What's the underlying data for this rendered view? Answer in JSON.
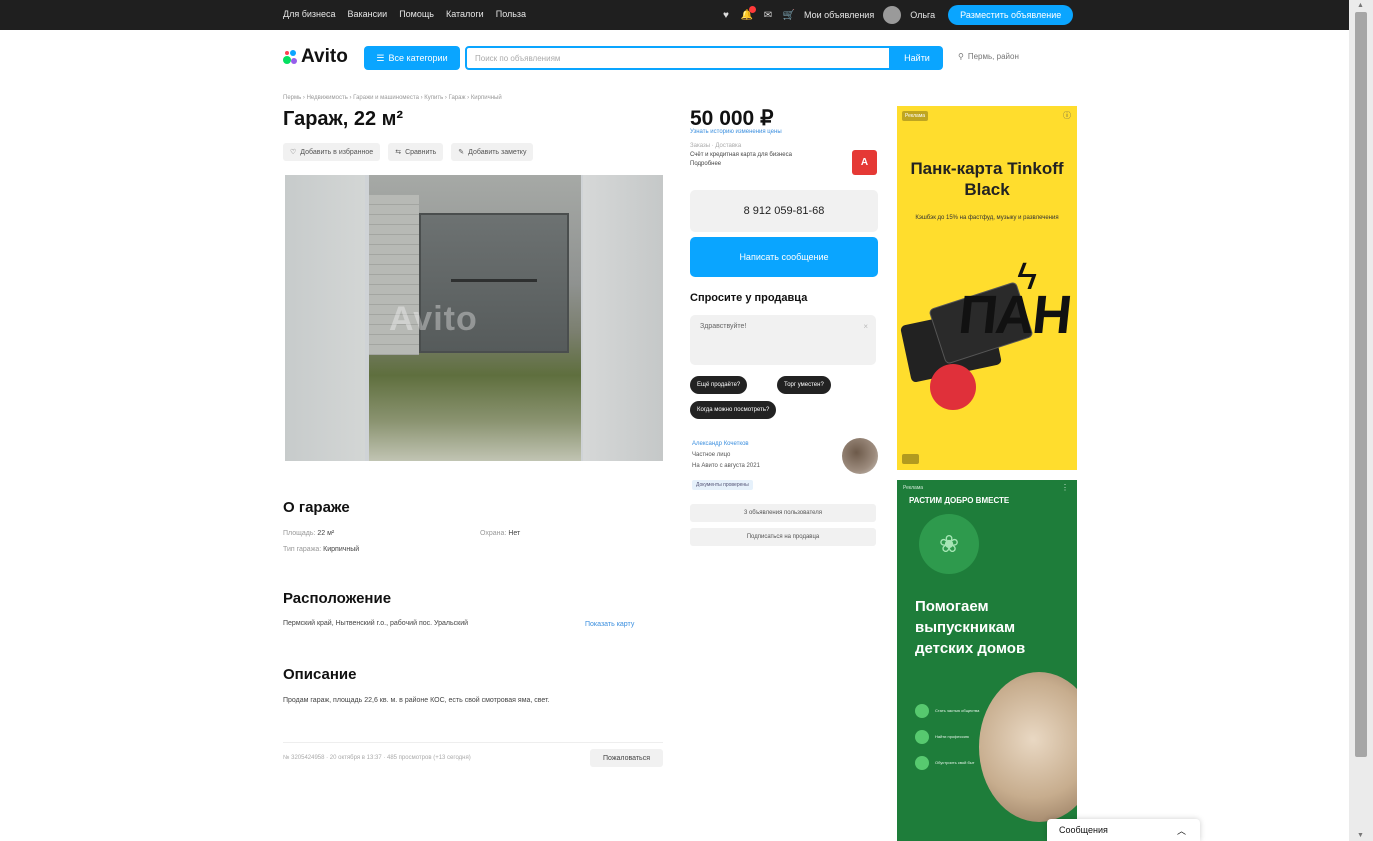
{
  "topbar": {
    "nav": [
      "Для бизнеса",
      "Вакансии",
      "Помощь",
      "Каталоги",
      "Польза"
    ],
    "my_listings": "Мои объявления",
    "username": "Ольга",
    "post_button": "Разместить объявление"
  },
  "header": {
    "logo": "Avito",
    "categories_button": "Все категории",
    "search_placeholder": "Поиск по объявлениям",
    "search_button": "Найти",
    "location": "Пермь, район"
  },
  "breadcrumbs": "Пермь › Недвижимость › Гаражи и машиноместа › Купить › Гараж › Кирпичный",
  "listing": {
    "title": "Гараж, 22 м²",
    "actions": [
      "Добавить в избранное",
      "Сравнить",
      "Добавить заметку"
    ],
    "watermark": "Avito",
    "about_heading": "О гараже",
    "params": [
      {
        "key": "Площадь:",
        "value": "22 м²"
      },
      {
        "key": "Охрана:",
        "value": "Нет"
      },
      {
        "key": "Тип гаража:",
        "value": "Кирпичный"
      }
    ],
    "location_heading": "Расположение",
    "address": "Пермский край, Нытвенский г.о., рабочий пос. Уральский",
    "show_map": "Показать карту",
    "description_heading": "Описание",
    "description": "Продам гараж, площадь 22,6 кв. м. в районе КОС, есть свой смотровая яма, свет.",
    "meta": "№ 3205424958 · 20 октября в 13:37 · 485 просмотров (+13 сегодня)",
    "complain_button": "Пожаловаться"
  },
  "sidebar": {
    "price": "50 000 ₽",
    "price_history": "Узнать историю изменения цены",
    "notice_small": "Заказы · Доставка",
    "notice_text_1": "Счёт и кредитная карта для бизнеса",
    "notice_text_2": "Подробнее",
    "badge": "A",
    "phone": "8 912 059-81-68",
    "write_button": "Написать сообщение",
    "ask_heading": "Спросите у продавца",
    "ask_placeholder": "Здравствуйте!",
    "chips": [
      "Ещё продаёте?",
      "Торг уместен?",
      "Когда можно посмотреть?"
    ],
    "seller_name": "Александр Кочетков",
    "seller_type": "Частное лицо",
    "seller_since": "На Авито с августа 2021",
    "verified": "Документы проверены",
    "other_listings": "3 объявления пользователя",
    "subscribe": "Подписаться на продавца"
  },
  "ads": {
    "label": "Реклама",
    "ad1_title": "Панк-карта Tinkoff Black",
    "ad1_sub": "Кэшбэк до 15% на фастфуд, музыку и развлечения",
    "ad1_pan": "ПАН",
    "ad2_arc": "РАСТИМ ДОБРО ВМЕСТЕ",
    "ad2_title": "Помогаем выпускникам детских домов",
    "ad2_bullets": [
      "Стать частью общества",
      "Найти профессию",
      "Обустроить свой быт"
    ]
  },
  "messages_widget": "Сообщения",
  "colors": {
    "accent": "#0aa5ff",
    "topbar": "#1f1f1f",
    "ad_yellow": "#ffdd2d",
    "ad_green": "#1e7d3a"
  }
}
